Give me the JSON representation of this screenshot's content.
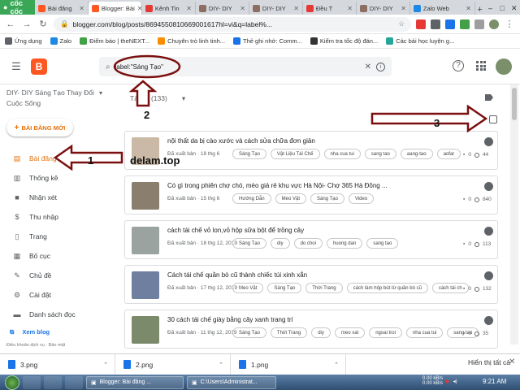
{
  "browser": {
    "brand": "cốc cốc",
    "tabs": [
      {
        "label": "Bài đăng",
        "color": "#ff5722",
        "active": false
      },
      {
        "label": "Blogger: Bài",
        "color": "#ff5722",
        "active": true
      },
      {
        "label": "Kênh Tin",
        "color": "#e53935",
        "active": false
      },
      {
        "label": "DIY- DIY",
        "color": "#8d6e63",
        "active": false
      },
      {
        "label": "DIY- DIY",
        "color": "#8d6e63",
        "active": false
      },
      {
        "label": "Đều T",
        "color": "#e53935",
        "active": false
      },
      {
        "label": "DIY- DIY",
        "color": "#8d6e63",
        "active": false
      },
      {
        "label": "Zalo Web",
        "color": "#1e88e5",
        "active": false
      }
    ],
    "url": "blogger.com/blog/posts/8694550810669001617hl=vi&q=label%...",
    "bookmarks": [
      {
        "label": "Ứng dụng",
        "color": "#5f6368"
      },
      {
        "label": "Zalo",
        "color": "#1e88e5"
      },
      {
        "label": "Điểm báo | theNEXT...",
        "color": "#43a047"
      },
      {
        "label": "Chuyên trò linh tinh...",
        "color": "#fb8c00"
      },
      {
        "label": "Thẻ ghi nhớ: Comm...",
        "color": "#1a73e8"
      },
      {
        "label": "Kiểm tra tốc độ đán...",
        "color": "#333333"
      },
      {
        "label": "Các bài học luyện g...",
        "color": "#26a69a"
      }
    ]
  },
  "header": {
    "logo": "B",
    "search_value": "label:\"Sáng Tạo\""
  },
  "sidebar": {
    "blog_name": "DIY- DIY Sáng Tạo Thay Đổi Cuộc Sống",
    "new_post": "BÀI ĐĂNG MỚI",
    "items": [
      {
        "label": "Bài đăng",
        "icon": "posts-icon",
        "glyph": "▤"
      },
      {
        "label": "Thống kê",
        "icon": "stats-icon",
        "glyph": "▥"
      },
      {
        "label": "Nhận xét",
        "icon": "comments-icon",
        "glyph": "■"
      },
      {
        "label": "Thu nhập",
        "icon": "earnings-icon",
        "glyph": "$"
      },
      {
        "label": "Trang",
        "icon": "pages-icon",
        "glyph": "▯"
      },
      {
        "label": "Bố cục",
        "icon": "layout-icon",
        "glyph": "▦"
      },
      {
        "label": "Chủ đề",
        "icon": "theme-icon",
        "glyph": "✎"
      },
      {
        "label": "Cài đặt",
        "icon": "settings-icon",
        "glyph": "⚙"
      },
      {
        "label": "Danh sách đọc",
        "icon": "reading-list-icon",
        "glyph": "▬"
      }
    ],
    "view_blog": "Xem blog",
    "footer": "Điều khoản dịch vụ · Bảo mật"
  },
  "main": {
    "filter_label": "Tất cả (1",
    "filter_count": "33)",
    "posts": [
      {
        "title": "nội thất da bị cào xước và cách sửa chữa đơn giản",
        "meta": "Đã xuất bản · 18 thg 6",
        "tags": [
          "Sáng Tạo",
          "Vật Liệu Tái Chế",
          "nha cua tui",
          "sang tao",
          "aang-tao",
          "aofar"
        ],
        "views": "44",
        "thumb": "#c9b9a6"
      },
      {
        "title": "Có gì trong phiên chợ chó, mèo giá rẻ khu vực Hà Nội- Chợ 365 Hà Đông ...",
        "meta": "Đã xuất bản · 15 thg 6",
        "tags": [
          "Hướng Dẫn",
          "Meo Vặt",
          "Sáng Tạo",
          "Video"
        ],
        "views": "840",
        "thumb": "#8a7f6e"
      },
      {
        "title": "cách tái chế vỏ lon,vỏ hộp sữa bột để trồng cây",
        "meta": "Đã xuất bản · 18 thg 12, 2019",
        "tags": [
          "Sáng Tạo",
          "diy",
          "do choi",
          "huong dan",
          "sang tao"
        ],
        "views": "113",
        "thumb": "#9aa3a0"
      },
      {
        "title": "Cách tái chế quần bò cũ thành chiếc túi xinh xắn",
        "meta": "Đã xuất bản · 17 thg 12, 2019",
        "tags": [
          "Meo Vặt",
          "Sáng Tạo",
          "Thời Trang",
          "cách làm hộp bút từ quần bò cũ",
          "cách tái ch"
        ],
        "views": "132",
        "thumb": "#6f7fa0"
      },
      {
        "title": "30 cách tái chế giày bằng cây xanh trang trí",
        "meta": "Đã xuất bản · 11 thg 12, 2019",
        "tags": [
          "Sáng Tạo",
          "Thời Trang",
          "diy",
          "meo vat",
          "ngoai troi",
          "nha cua tui",
          "sang tao"
        ],
        "views": "35",
        "thumb": "#7c8a6c"
      }
    ]
  },
  "annotations": {
    "watermark": "delam.top",
    "num1": "1",
    "num2": "2",
    "num3": "3",
    "arrow_color": "#7b0f0f"
  },
  "downloads": {
    "files": [
      "3.png",
      "2.png",
      "1.png"
    ],
    "show_all": "Hiển thị tất cả"
  },
  "taskbar": {
    "windows": [
      "Blogger: Bài đăng ...",
      "C:\\Users\\Administrat..."
    ],
    "net_up": "0.00 kB/s",
    "net_down": "0.00 kB/s",
    "time": "9:21 AM"
  }
}
